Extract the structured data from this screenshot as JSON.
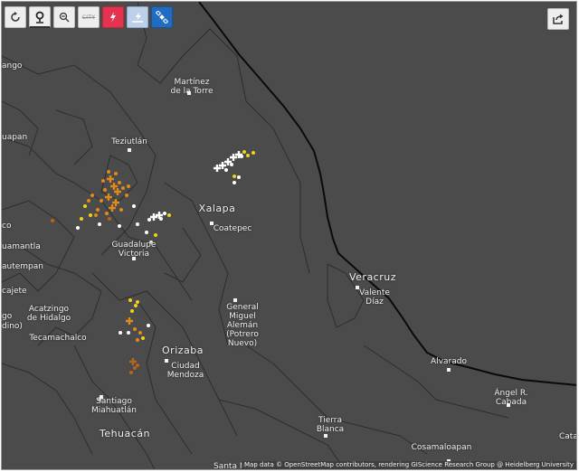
{
  "toolbar": {
    "buttons": [
      {
        "name": "refresh-icon"
      },
      {
        "name": "pin-icon"
      },
      {
        "name": "zoom-out-icon"
      },
      {
        "name": "city-toggle",
        "label": "CITY"
      },
      {
        "name": "lightning-cloud-to-ground-icon",
        "color": "#e5334f"
      },
      {
        "name": "lightning-intracloud-icon",
        "color": "#bcd0ea"
      },
      {
        "name": "satellite-icon",
        "color": "#1f6cc2"
      }
    ],
    "share_icon": "share-icon"
  },
  "places": [
    {
      "id": "martinez",
      "label": "Martínez\nde la Torre"
    },
    {
      "id": "teziutlan",
      "label": "Teziutlán"
    },
    {
      "id": "xalapa",
      "label": "Xalapa"
    },
    {
      "id": "coatepec",
      "label": "Coatepec"
    },
    {
      "id": "guadalupe",
      "label": "Guadalupe\nVictoria"
    },
    {
      "id": "veracruz",
      "label": "Veracruz"
    },
    {
      "id": "valente",
      "label": "Valente\nDíaz"
    },
    {
      "id": "general",
      "label": "General\nMiguel\nAlemán\n(Potrero\nNuevo)"
    },
    {
      "id": "acatzingo",
      "label": "Acatzingo\nde Hidalgo"
    },
    {
      "id": "tecamachalco",
      "label": "Tecamachalco"
    },
    {
      "id": "orizaba",
      "label": "Orizaba"
    },
    {
      "id": "mendoza",
      "label": "Ciudad\nMendoza"
    },
    {
      "id": "alvarado",
      "label": "Alvarado"
    },
    {
      "id": "santiago",
      "label": "Santiago\nMiahuatlán"
    },
    {
      "id": "tehuacan",
      "label": "Tehuacán"
    },
    {
      "id": "tierra",
      "label": "Tierra\nBlanca"
    },
    {
      "id": "angel",
      "label": "Ángel R.\nCabada"
    },
    {
      "id": "cosamaloapan",
      "label": "Cosamaloapan"
    },
    {
      "id": "cata",
      "label": "Cata"
    },
    {
      "id": "santa",
      "label": "Santa Mari"
    },
    {
      "id": "ango",
      "label": "ango"
    },
    {
      "id": "uapan",
      "label": "uapan"
    },
    {
      "id": "co",
      "label": "co"
    },
    {
      "id": "uamantla",
      "label": "uamantla"
    },
    {
      "id": "autempan",
      "label": "autempan"
    },
    {
      "id": "acajete",
      "label": "cajete"
    },
    {
      "id": "go",
      "label": "go"
    },
    {
      "id": "dino",
      "label": "dino)"
    }
  ],
  "attribution": "Map data © OpenStreetMap contributors, rendering GIScience Research Group @ Heidelberg University",
  "colors": {
    "land": "#4b4b4b",
    "coast": "#0a0a0a",
    "borders": "#2e2e2e",
    "strike_recent": "#ffffff",
    "strike_mid": "#f5d21a",
    "strike_old": "#e08a1c",
    "strike_oldest": "#b5651d"
  }
}
